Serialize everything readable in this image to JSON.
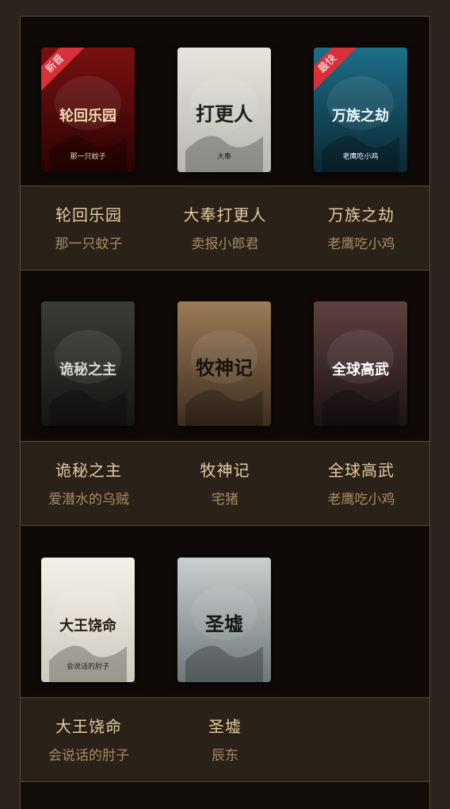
{
  "books": [
    {
      "title": "轮回乐园",
      "author": "那一只蚊子",
      "badge": "新晋",
      "cover_text": "轮回乐园",
      "cover_sub": "那一只蚊子",
      "palette": [
        "#7a1010",
        "#2a0303"
      ],
      "text_color": "#f6dbb1",
      "cover_icon": "ornate-sword-icon"
    },
    {
      "title": "大奉打更人",
      "author": "卖报小郎君",
      "badge": "",
      "cover_text": "打更人",
      "cover_sub": "大奉",
      "palette": [
        "#e6e4dc",
        "#b9b8b0"
      ],
      "text_color": "#1d1d1d",
      "cover_icon": "mountain-figure-icon"
    },
    {
      "title": "万族之劫",
      "author": "老鹰吃小鸡",
      "badge": "最快",
      "cover_text": "万族之劫",
      "cover_sub": "老鹰吃小鸡",
      "palette": [
        "#1d6f89",
        "#0b2633"
      ],
      "text_color": "#e9fbff",
      "cover_icon": "city-ruins-icon"
    },
    {
      "title": "诡秘之主",
      "author": "爱潜水的乌贼",
      "badge": "",
      "cover_text": "诡秘之主",
      "cover_sub": "",
      "palette": [
        "#3b3b37",
        "#151513"
      ],
      "text_color": "#d8d8d2",
      "cover_icon": "gothic-frame-icon"
    },
    {
      "title": "牧神记",
      "author": "宅猪",
      "badge": "",
      "cover_text": "牧神记",
      "cover_sub": "",
      "palette": [
        "#9c7b58",
        "#3d2d1f"
      ],
      "text_color": "#1a1209",
      "cover_icon": "traveler-silhouette-icon"
    },
    {
      "title": "全球高武",
      "author": "老鹰吃小鸡",
      "badge": "",
      "cover_text": "全球高武",
      "cover_sub": "",
      "palette": [
        "#604040",
        "#1a1212"
      ],
      "text_color": "#ffffff",
      "cover_icon": "street-figure-icon"
    },
    {
      "title": "大王饶命",
      "author": "会说话的肘子",
      "badge": "",
      "cover_text": "大王饶命",
      "cover_sub": "会说话的肘子",
      "palette": [
        "#f3f0e8",
        "#cfcac0"
      ],
      "text_color": "#2a1e10",
      "cover_icon": "anime-boy-icon"
    },
    {
      "title": "圣墟",
      "author": "辰东",
      "badge": "",
      "cover_text": "圣墟",
      "cover_sub": "",
      "palette": [
        "#c9cfcf",
        "#6d7778"
      ],
      "text_color": "#121617",
      "cover_icon": "misty-mountain-icon"
    }
  ]
}
